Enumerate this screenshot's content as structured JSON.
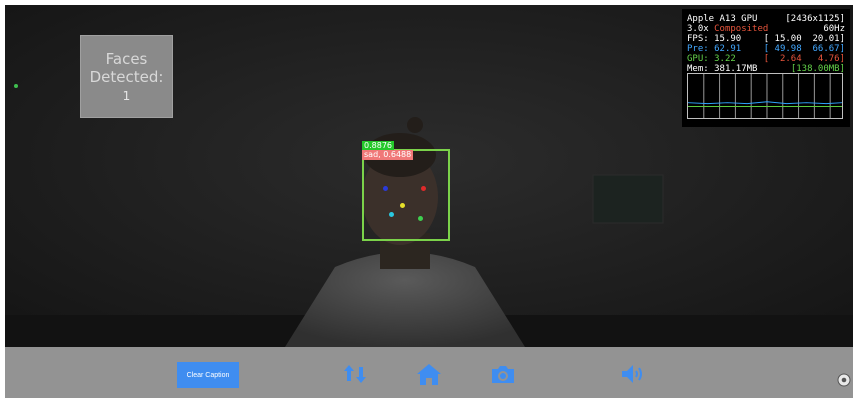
{
  "camera": {
    "faces_panel": {
      "label": "Faces\nDetected:",
      "count": "1"
    },
    "stats_overlay": {
      "gpu_name": "Apple A13 GPU",
      "resolution": "[2436x1125]",
      "scale": "3.0x",
      "mode": "Composited",
      "refresh": "60Hz",
      "fps_label": "FPS:",
      "fps_value": "15.90",
      "fps_range": "[ 15.00  20.01]",
      "pre_label": "Pre:",
      "pre_value": "62.91",
      "pre_range": "[ 49.98  66.67]",
      "gpu_label": "GPU:",
      "gpu_value": "3.22",
      "gpu_range": "[  2.64   4.76]",
      "mem_label": "Mem:",
      "mem_value": "381.17MB",
      "mem_peak": "[138.00MB]"
    },
    "detection": {
      "confidence": "0.8876",
      "emotion": "sad, 0.6488"
    }
  },
  "toolbar": {
    "clear_caption_label": "Clear Caption"
  },
  "icons": {
    "switch": "switch-camera-icon",
    "home": "home-icon",
    "camera": "camera-icon",
    "sound": "speaker-icon",
    "settings": "settings-icon"
  },
  "colors": {
    "accent_blue": "#3f8df0",
    "face_box": "#7bd24a",
    "toolbar_bg": "#939393"
  }
}
